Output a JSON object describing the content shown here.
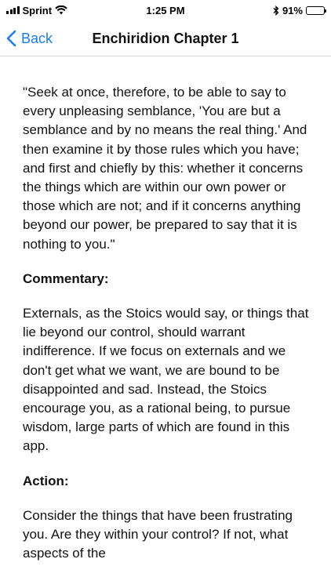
{
  "status_bar": {
    "carrier": "Sprint",
    "time": "1:25 PM",
    "battery_percent": "91%",
    "battery_level": 0.91,
    "icons": [
      "signal-icon",
      "wifi-icon",
      "bluetooth-icon",
      "battery-icon"
    ]
  },
  "nav": {
    "back_label": "Back",
    "back_icon": "chevron-left-icon",
    "title": "Enchiridion Chapter 1",
    "accent_color": "#1a7cf5"
  },
  "content": {
    "quote": "\"Seek at once, therefore, to be able to say to every unpleasing semblance, 'You are but a semblance and by no means the real thing.' And then examine it by those rules which you have; and first and chiefly by this: whether it concerns the things which are within our own power or those which are not; and if it concerns anything beyond our power, be prepared to say that it is nothing to you.\"",
    "commentary_heading": "Commentary:",
    "commentary": "Externals, as the Stoics would say, or things that lie beyond our control, should warrant indifference. If we focus on externals and we don't get what we want, we are bound to be disappointed and sad. Instead, the Stoics encourage you, as a rational being, to pursue wisdom, large parts of which are found in this app.",
    "action_heading": "Action:",
    "action": "Consider the things that have been frustrating you. Are they within your control? If not, what aspects of the"
  }
}
